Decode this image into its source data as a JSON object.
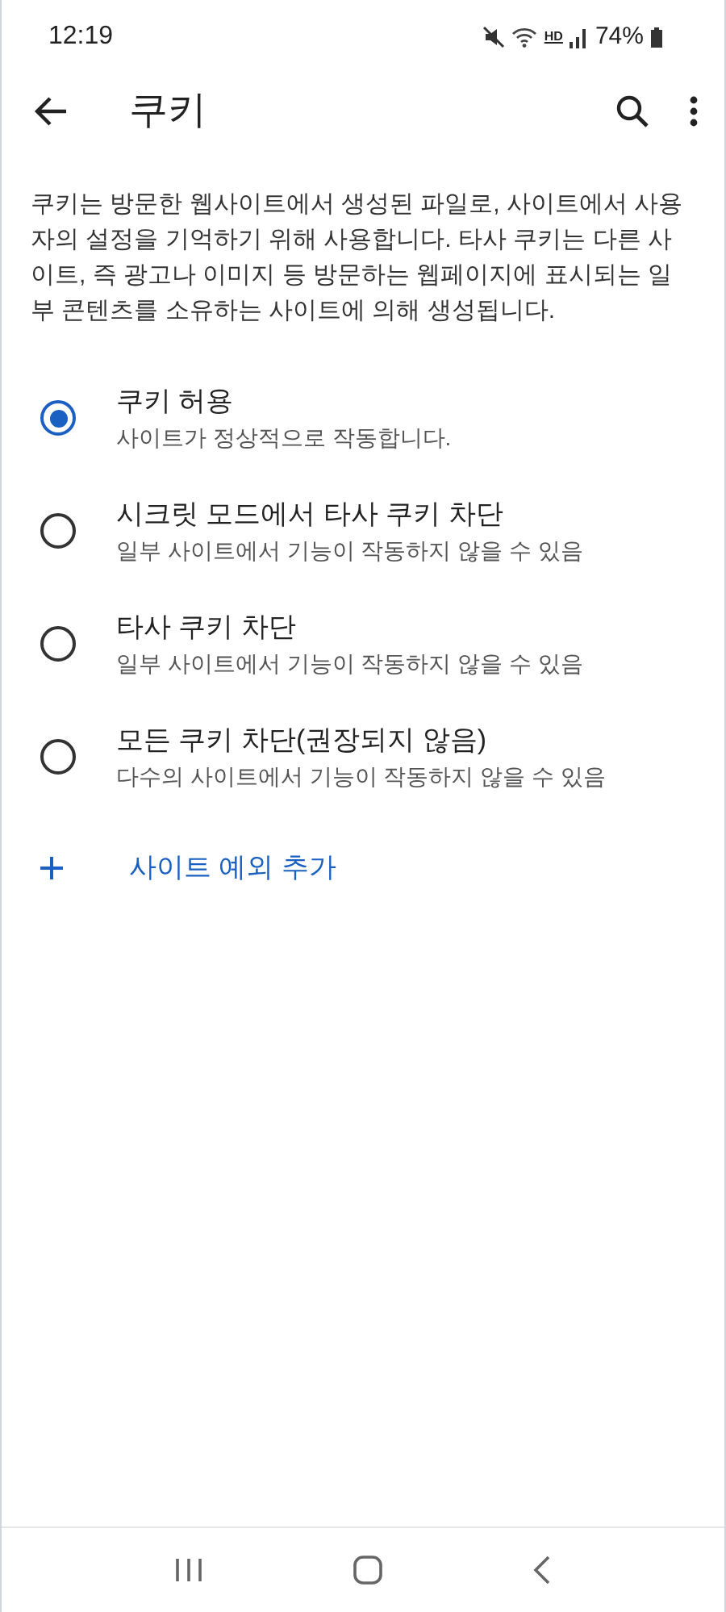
{
  "status_bar": {
    "time": "12:19",
    "hd_label": "HD",
    "battery": "74%"
  },
  "app_bar": {
    "title": "쿠키"
  },
  "description": "쿠키는 방문한 웹사이트에서 생성된 파일로, 사이트에서 사용자의 설정을 기억하기 위해 사용합니다. 타사 쿠키는 다른 사이트, 즉 광고나 이미지 등 방문하는 웹페이지에 표시되는 일부 콘텐츠를 소유하는 사이트에 의해 생성됩니다.",
  "options": [
    {
      "title": "쿠키 허용",
      "subtitle": "사이트가 정상적으로 작동합니다.",
      "selected": true
    },
    {
      "title": "시크릿 모드에서 타사 쿠키 차단",
      "subtitle": "일부 사이트에서 기능이 작동하지 않을 수 있음",
      "selected": false
    },
    {
      "title": "타사 쿠키 차단",
      "subtitle": "일부 사이트에서 기능이 작동하지 않을 수 있음",
      "selected": false
    },
    {
      "title": "모든 쿠키 차단(권장되지 않음)",
      "subtitle": "다수의 사이트에서 기능이 작동하지 않을 수 있음",
      "selected": false
    }
  ],
  "add_exception": {
    "label": "사이트 예외 추가"
  }
}
